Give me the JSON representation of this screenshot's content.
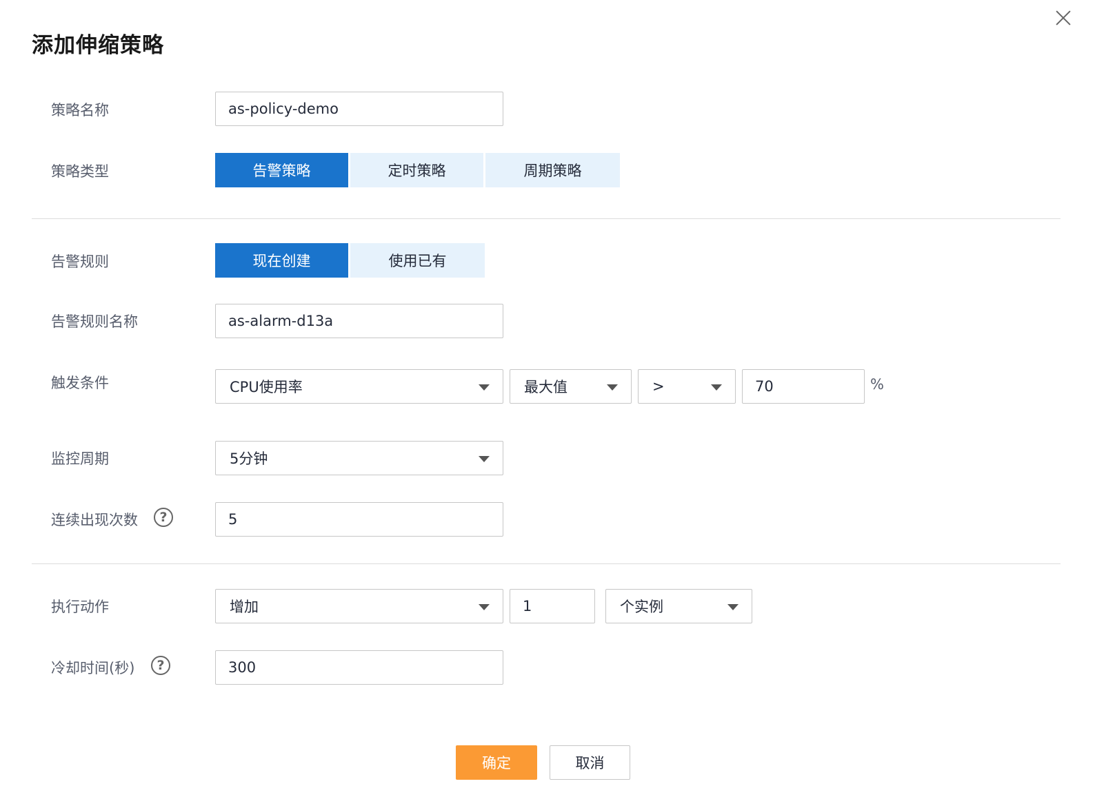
{
  "dialog": {
    "title": "添加伸缩策略"
  },
  "form": {
    "policy_name": {
      "label": "策略名称",
      "value": "as-policy-demo"
    },
    "policy_type": {
      "label": "策略类型",
      "options": [
        "告警策略",
        "定时策略",
        "周期策略"
      ],
      "selected": "告警策略"
    },
    "alarm_rule": {
      "label": "告警规则",
      "options": [
        "现在创建",
        "使用已有"
      ],
      "selected": "现在创建"
    },
    "alarm_rule_name": {
      "label": "告警规则名称",
      "value": "as-alarm-d13a"
    },
    "trigger": {
      "label": "触发条件",
      "metric": "CPU使用率",
      "aggregation": "最大值",
      "operator": ">",
      "threshold": "70",
      "unit": "%"
    },
    "monitor_period": {
      "label": "监控周期",
      "value": "5分钟"
    },
    "consecutive": {
      "label": "连续出现次数",
      "value": "5",
      "help_icon": "?"
    },
    "action": {
      "label": "执行动作",
      "operation": "增加",
      "count": "1",
      "unit": "个实例"
    },
    "cooldown": {
      "label": "冷却时间(秒)",
      "value": "300",
      "help_icon": "?"
    }
  },
  "footer": {
    "confirm_label": "确定",
    "cancel_label": "取消"
  },
  "colors": {
    "primary": "#1a74cc",
    "segment_inactive": "#e6f2fc",
    "confirm": "#fb9a34"
  }
}
